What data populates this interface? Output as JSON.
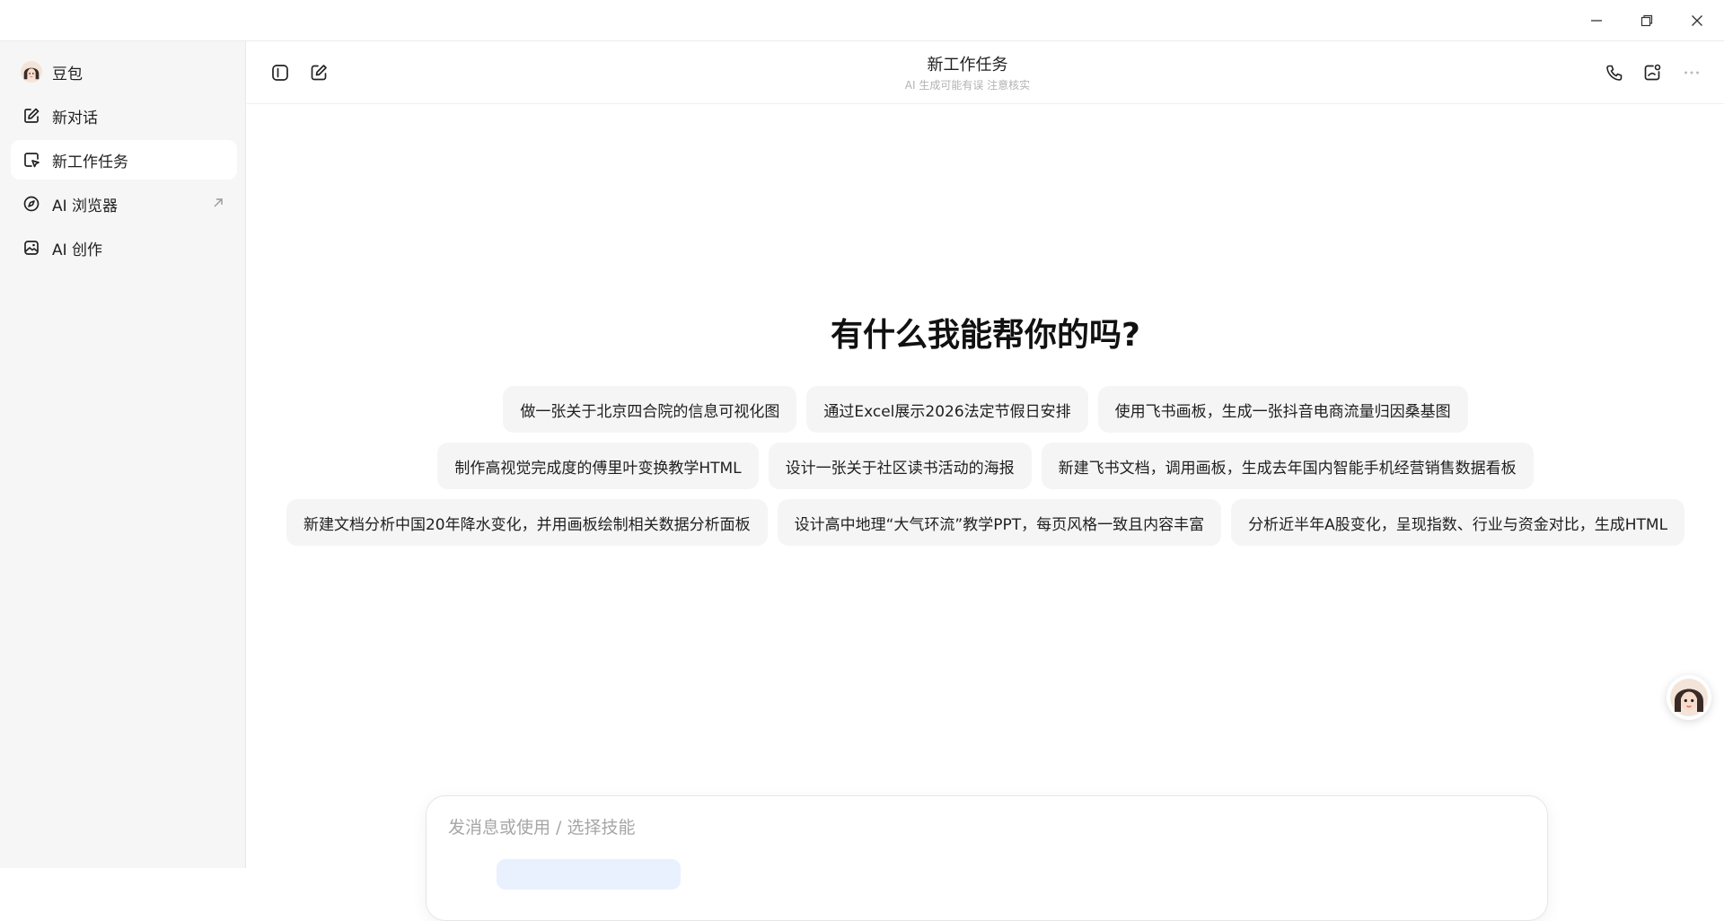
{
  "window": {
    "controls": [
      "minimize",
      "restore",
      "close"
    ]
  },
  "sidebar": {
    "items": [
      {
        "label": "豆包",
        "icon": "doubao-avatar-icon"
      },
      {
        "label": "新对话",
        "icon": "edit-icon"
      },
      {
        "label": "新工作任务",
        "icon": "task-icon",
        "active": true
      },
      {
        "label": "AI 浏览器",
        "icon": "compass-icon",
        "external": true
      },
      {
        "label": "AI 创作",
        "icon": "image-icon"
      }
    ]
  },
  "header": {
    "title": "新工作任务",
    "subtitle": "AI 生成可能有误 注意核实"
  },
  "main": {
    "welcome": "有什么我能帮你的吗?",
    "suggestions": [
      [
        "做一张关于北京四合院的信息可视化图",
        "通过Excel展示2026法定节假日安排",
        "使用飞书画板，生成一张抖音电商流量归因桑基图"
      ],
      [
        "制作高视觉完成度的傅里叶变换教学HTML",
        "设计一张关于社区读书活动的海报",
        "新建飞书文档，调用画板，生成去年国内智能手机经营销售数据看板"
      ],
      [
        "新建文档分析中国20年降水变化，并用画板绘制相关数据分析面板",
        "设计高中地理“大气环流”教学PPT，每页风格一致且内容丰富",
        "分析近半年A股变化，呈现指数、行业与资金对比，生成HTML"
      ]
    ]
  },
  "composer": {
    "placeholder": "发消息或使用 / 选择技能"
  }
}
